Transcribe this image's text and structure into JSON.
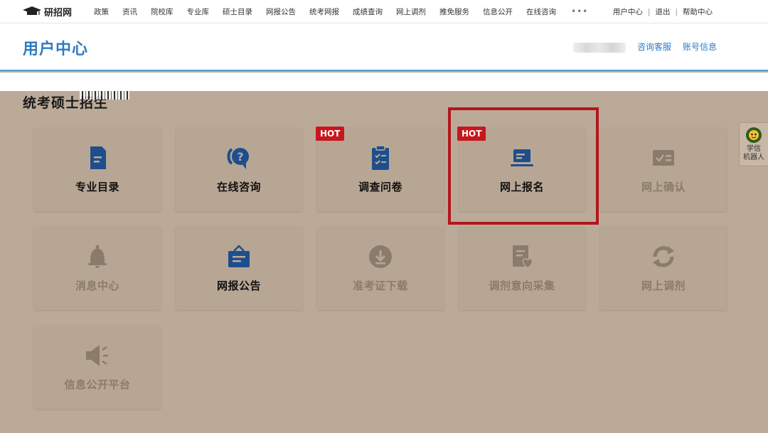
{
  "nav": {
    "logo_text": "研招网",
    "items": [
      "政策",
      "资讯",
      "院校库",
      "专业库",
      "硕士目录",
      "网报公告",
      "统考网报",
      "成绩查询",
      "网上调剂",
      "推免服务",
      "信息公开",
      "在线咨询"
    ],
    "more": "•••",
    "right": {
      "user_center": "用户中心",
      "logout": "退出",
      "help": "帮助中心"
    }
  },
  "header": {
    "title": "用户中心",
    "consult_service": "咨询客服",
    "account_info": "账号信息"
  },
  "section_title": "统考硕士招生",
  "cards": [
    {
      "label": "专业目录",
      "icon": "document-icon",
      "hot": false,
      "state": "active"
    },
    {
      "label": "在线咨询",
      "icon": "question-chat-icon",
      "hot": false,
      "state": "active"
    },
    {
      "label": "调查问卷",
      "icon": "clipboard-check-icon",
      "hot": true,
      "state": "active"
    },
    {
      "label": "网上报名",
      "icon": "laptop-icon",
      "hot": true,
      "state": "active"
    },
    {
      "label": "网上确认",
      "icon": "id-card-check-icon",
      "hot": false,
      "state": "dim"
    },
    {
      "label": "消息中心",
      "icon": "bell-icon",
      "hot": false,
      "state": "dim"
    },
    {
      "label": "网报公告",
      "icon": "notice-board-icon",
      "hot": false,
      "state": "active"
    },
    {
      "label": "准考证下载",
      "icon": "download-icon",
      "hot": false,
      "state": "dim"
    },
    {
      "label": "调剂意向采集",
      "icon": "heart-form-icon",
      "hot": false,
      "state": "dim"
    },
    {
      "label": "网上调剂",
      "icon": "refresh-icon",
      "hot": false,
      "state": "dim"
    },
    {
      "label": "信息公开平台",
      "icon": "speaker-icon",
      "hot": false,
      "state": "dim"
    }
  ],
  "hot_badge": "HOT",
  "robot": {
    "line1": "学信",
    "line2": "机器人"
  },
  "colors": {
    "brand_blue": "#2c7bc4",
    "icon_blue": "#1e4e8c",
    "hot_red": "#c8161d",
    "overlay": "#bcaa99"
  }
}
